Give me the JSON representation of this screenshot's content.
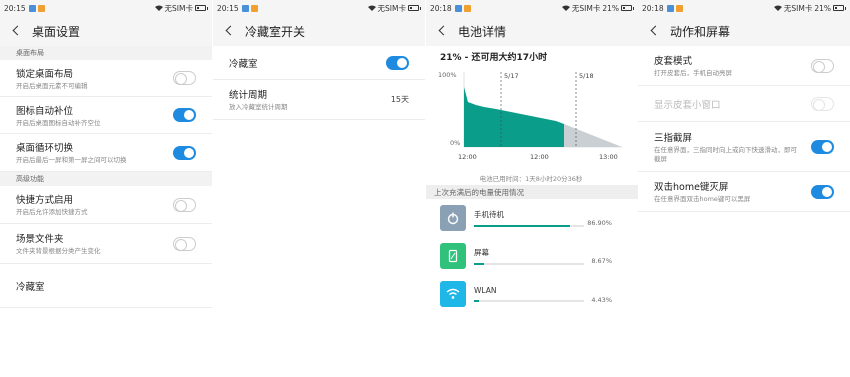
{
  "screens": [
    {
      "status": {
        "time": "20:15",
        "carrier": "无SIM卡"
      },
      "title": "桌面设置",
      "sections": [
        {
          "header": "桌面布局"
        },
        {
          "header": "高级功能"
        }
      ],
      "rows": [
        {
          "label": "锁定桌面布局",
          "desc": "开启后桌面元素不可编辑",
          "toggle": "off"
        },
        {
          "label": "图标自动补位",
          "desc": "开启后桌面图标自动补齐空位",
          "toggle": "on"
        },
        {
          "label": "桌面循环切换",
          "desc": "开启后最后一屏和第一屏之间可以切换",
          "toggle": "on"
        },
        {
          "label": "快捷方式启用",
          "desc": "开启后允许添加快捷方式",
          "toggle": "off"
        },
        {
          "label": "场景文件夹",
          "desc": "文件夹背景根据分类产生变化",
          "toggle": "off"
        },
        {
          "label": "冷藏室"
        }
      ]
    },
    {
      "status": {
        "time": "20:15",
        "carrier": "无SIM卡"
      },
      "title": "冷藏室开关",
      "rows": [
        {
          "label": "冷藏室",
          "toggle": "on"
        },
        {
          "label": "统计周期",
          "desc": "放入冷藏室统计周期",
          "value": "15天"
        }
      ]
    },
    {
      "status": {
        "time": "20:18",
        "carrier": "无SIM卡",
        "battery": "21%"
      },
      "title": "电池详情",
      "headline": "21% - 还可用大约17小时",
      "chart_data": {
        "type": "area",
        "y_labels": [
          "100%",
          "0%"
        ],
        "x_labels": [
          "12:00",
          "12:00",
          "13:00"
        ],
        "markers": [
          "5/17",
          "5/18"
        ],
        "caption": "电池已用时间：1天8小时20分36秒"
      },
      "usage_header": "上次充满后的电量使用情况",
      "usage": [
        {
          "name": "手机待机",
          "percent": "86.90%",
          "value": 86.9,
          "icon": "power-icon",
          "color": "#8aa0b5"
        },
        {
          "name": "屏幕",
          "percent": "8.67%",
          "value": 8.67,
          "icon": "phone-screen-icon",
          "color": "#30c27a"
        },
        {
          "name": "WLAN",
          "percent": "4.43%",
          "value": 4.43,
          "icon": "wifi-icon",
          "color": "#1fb6e8"
        }
      ]
    },
    {
      "status": {
        "time": "20:18",
        "carrier": "无SIM卡",
        "battery": "21%"
      },
      "title": "动作和屏幕",
      "rows": [
        {
          "label": "皮套模式",
          "desc": "打开皮套后，手机自动亮屏",
          "toggle": "off"
        },
        {
          "label": "显示皮套小窗口",
          "toggle": "off",
          "disabled": true
        },
        {
          "label": "三指截屏",
          "desc": "在任意界面，三指同时向上或向下快速滑动，即可截屏",
          "toggle": "on"
        },
        {
          "label": "双击home键灭屏",
          "desc": "在任意界面双击home键可以黑屏",
          "toggle": "on"
        }
      ]
    }
  ]
}
